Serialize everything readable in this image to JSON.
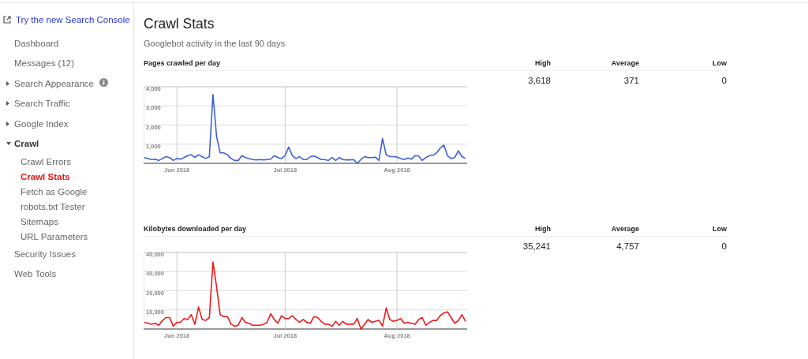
{
  "sidebar": {
    "new_console_link": "Try the new Search Console",
    "items": [
      {
        "label": "Dashboard",
        "kind": "link",
        "selected": false,
        "info": false
      },
      {
        "label": "Messages (12)",
        "kind": "link",
        "selected": false,
        "info": false
      },
      {
        "label": "Search Appearance",
        "kind": "group",
        "expanded": false,
        "selected": false,
        "info": true
      },
      {
        "label": "Search Traffic",
        "kind": "group",
        "expanded": false,
        "selected": false,
        "info": false
      },
      {
        "label": "Google Index",
        "kind": "group",
        "expanded": false,
        "selected": false,
        "info": false
      },
      {
        "label": "Crawl",
        "kind": "group",
        "expanded": true,
        "selected": false,
        "info": false,
        "children": [
          {
            "label": "Crawl Errors",
            "selected": false
          },
          {
            "label": "Crawl Stats",
            "selected": true
          },
          {
            "label": "Fetch as Google",
            "selected": false
          },
          {
            "label": "robots.txt Tester",
            "selected": false
          },
          {
            "label": "Sitemaps",
            "selected": false
          },
          {
            "label": "URL Parameters",
            "selected": false
          }
        ]
      },
      {
        "label": "Security Issues",
        "kind": "link",
        "selected": false,
        "info": false
      },
      {
        "label": "Web Tools",
        "kind": "link",
        "selected": false,
        "info": false
      }
    ]
  },
  "page": {
    "title": "Crawl Stats",
    "subtitle": "Googlebot activity in the last 90 days",
    "sections": [
      {
        "stats": [
          {
            "label": "High",
            "value": "3,618"
          },
          {
            "label": "Average",
            "value": "371"
          },
          {
            "label": "Low",
            "value": "0"
          }
        ],
        "chart_data": {
          "type": "line",
          "title": "Pages crawled per day",
          "grid": true,
          "categories": [
            null,
            null,
            null,
            null,
            null,
            null,
            null,
            null,
            null,
            "Jun 2018",
            null,
            null,
            null,
            null,
            null,
            null,
            null,
            null,
            null,
            null,
            null,
            null,
            null,
            null,
            null,
            null,
            null,
            null,
            null,
            null,
            null,
            null,
            null,
            null,
            null,
            null,
            null,
            null,
            null,
            "Jul 2018",
            null,
            null,
            null,
            null,
            null,
            null,
            null,
            null,
            null,
            null,
            null,
            null,
            null,
            null,
            null,
            null,
            null,
            null,
            null,
            null,
            null,
            null,
            null,
            null,
            null,
            null,
            null,
            null,
            null,
            null,
            "Aug 2018",
            null,
            null,
            null,
            null,
            null,
            null,
            null,
            null,
            null,
            null,
            null,
            null,
            null,
            null,
            null,
            null,
            null,
            null,
            null
          ],
          "ylim": [
            0,
            4000
          ],
          "yticks": [
            {
              "value": 1000,
              "label": "1,000"
            },
            {
              "value": 2000,
              "label": "2,000"
            },
            {
              "value": 3000,
              "label": "3,000"
            },
            {
              "value": 4000,
              "label": "4,000"
            }
          ],
          "series": [
            {
              "color": "#3d5fd6",
              "values": [
                300,
                250,
                200,
                220,
                150,
                250,
                350,
                300,
                150,
                250,
                220,
                300,
                400,
                450,
                300,
                450,
                350,
                250,
                350,
                3600,
                1400,
                550,
                550,
                450,
                250,
                150,
                150,
                400,
                300,
                250,
                200,
                180,
                200,
                180,
                200,
                220,
                400,
                300,
                250,
                400,
                850,
                400,
                250,
                350,
                200,
                200,
                350,
                380,
                300,
                200,
                200,
                150,
                300,
                150,
                300,
                200,
                180,
                180,
                200,
                0,
                200,
                350,
                300,
                300,
                320,
                150,
                1300,
                450,
                350,
                350,
                330,
                250,
                200,
                280,
                220,
                400,
                380,
                150,
                300,
                400,
                420,
                550,
                800,
                950,
                400,
                250,
                300,
                650,
                350,
                250
              ]
            }
          ]
        }
      },
      {
        "stats": [
          {
            "label": "High",
            "value": "35,241"
          },
          {
            "label": "Average",
            "value": "4,757"
          },
          {
            "label": "Low",
            "value": "0"
          }
        ],
        "chart_data": {
          "type": "line",
          "title": "Kilobytes downloaded per day",
          "grid": true,
          "categories": [
            null,
            null,
            null,
            null,
            null,
            null,
            null,
            null,
            null,
            "Jun 2018",
            null,
            null,
            null,
            null,
            null,
            null,
            null,
            null,
            null,
            null,
            null,
            null,
            null,
            null,
            null,
            null,
            null,
            null,
            null,
            null,
            null,
            null,
            null,
            null,
            null,
            null,
            null,
            null,
            null,
            "Jul 2018",
            null,
            null,
            null,
            null,
            null,
            null,
            null,
            null,
            null,
            null,
            null,
            null,
            null,
            null,
            null,
            null,
            null,
            null,
            null,
            null,
            null,
            null,
            null,
            null,
            null,
            null,
            null,
            null,
            null,
            null,
            "Aug 2018",
            null,
            null,
            null,
            null,
            null,
            null,
            null,
            null,
            null,
            null,
            null,
            null,
            null,
            null,
            null,
            null,
            null,
            null,
            null
          ],
          "ylim": [
            0,
            40000
          ],
          "yticks": [
            {
              "value": 10000,
              "label": "10,000"
            },
            {
              "value": 20000,
              "label": "20,000"
            },
            {
              "value": 30000,
              "label": "30,000"
            },
            {
              "value": 40000,
              "label": "40,000"
            }
          ],
          "series": [
            {
              "color": "#f01818",
              "values": [
                3500,
                3000,
                2500,
                3000,
                2000,
                4500,
                6000,
                6000,
                1500,
                3500,
                3500,
                5500,
                5000,
                7500,
                2500,
                11500,
                5000,
                4500,
                6000,
                35000,
                22000,
                7500,
                6500,
                6500,
                2500,
                1500,
                2000,
                6000,
                3500,
                3000,
                2000,
                2000,
                2000,
                2500,
                3500,
                8000,
                5000,
                3000,
                7000,
                5500,
                5500,
                7000,
                5000,
                3500,
                5000,
                3500,
                3000,
                6500,
                6000,
                4000,
                2500,
                2500,
                1500,
                4000,
                2000,
                4000,
                2500,
                2500,
                2500,
                5500,
                0,
                2500,
                5000,
                3500,
                4000,
                4500,
                1500,
                11000,
                5000,
                4000,
                4500,
                5500,
                3000,
                3500,
                3000,
                2500,
                5000,
                6000,
                2000,
                3500,
                4500,
                4500,
                7000,
                8500,
                9000,
                6000,
                3000,
                4500,
                7500,
                4000
              ]
            }
          ]
        }
      }
    ]
  }
}
